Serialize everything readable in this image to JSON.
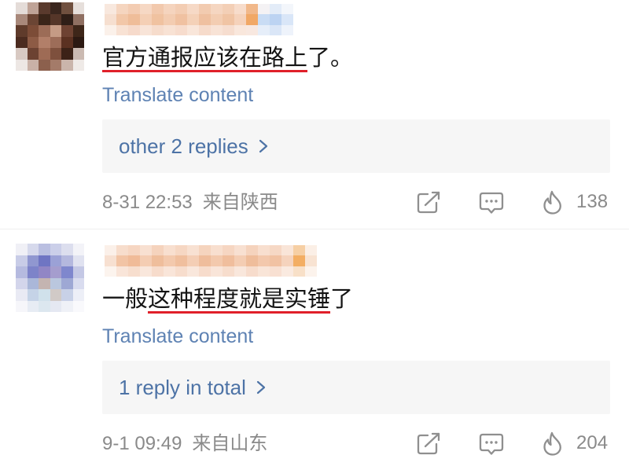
{
  "colors": {
    "text": "#141414",
    "link": "#5e82b3",
    "reply_link": "#4d73a6",
    "meta": "#8a8a8a",
    "icon": "#8f8f8f",
    "reply_background": "#f6f6f6",
    "annotation_red": "#e0202a",
    "divider": "#efefef"
  },
  "icons": {
    "share": "share-icon",
    "comment": "comment-icon",
    "like": "like-icon",
    "replies": "chevron-right-icon"
  },
  "comments": [
    {
      "avatar_mosaic": [
        [
          "#e4dcd8",
          "#bfa397",
          "#5a3a2d",
          "#3a261e",
          "#70503f",
          "#e6dfdb"
        ],
        [
          "#a8887a",
          "#6b4534",
          "#3b2519",
          "#553629",
          "#2f1e17",
          "#8f6f61"
        ],
        [
          "#5f3b2b",
          "#7c4c37",
          "#9c6c57",
          "#c59b85",
          "#6e4232",
          "#3e2619"
        ],
        [
          "#4b2b1f",
          "#8d5b45",
          "#b27f69",
          "#9d6d59",
          "#5b3121",
          "#2c1912"
        ],
        [
          "#d8c9c2",
          "#6c4232",
          "#9e6b55",
          "#7e503d",
          "#3c2217",
          "#cbbab2"
        ],
        [
          "#ede7e4",
          "#c9b1a7",
          "#8c604d",
          "#a47b69",
          "#cab5ab",
          "#efeae7"
        ]
      ],
      "username_mosaic": [
        [
          "#f8e8de",
          "#f5d5bf",
          "#f3ccb2",
          "#f6d8c4",
          "#f2c9ad",
          "#f5d4be",
          "#f3cdb3",
          "#f6d9c6",
          "#f2cbb0",
          "#f5d6c1",
          "#f3cfb6",
          "#f7dccb",
          "#f1b88a",
          "#f4f2f4",
          "#e3ecf8",
          "#f3f6fb"
        ],
        [
          "#f6dfd0",
          "#f2c7a8",
          "#efbd99",
          "#f4cfb5",
          "#f0c2a0",
          "#f3ccb1",
          "#f0c1a1",
          "#f4d1b8",
          "#efc0a0",
          "#f3cdb2",
          "#f0c4a4",
          "#f5d2bb",
          "#f1a866",
          "#c9dcf4",
          "#bcd3f2",
          "#d9e6f8"
        ],
        [
          "#fbf1ea",
          "#f8e2d4",
          "#f6dacb",
          "#f8e4d8",
          "#f6dccc",
          "#f8e2d4",
          "#f7dccd",
          "#f9e6da",
          "#f6dbcb",
          "#f8e3d6",
          "#f6ddcf",
          "#f9e7dc",
          "#f8e8e0",
          "#e6eef9",
          "#dae6f7",
          "#eef3fb"
        ]
      ],
      "text": [
        {
          "t": "官方通报应该在路上",
          "red_underline": true
        },
        {
          "t": "了。",
          "red_underline": false
        }
      ],
      "translate_label": "Translate content",
      "replies_label": "other 2 replies",
      "time": "8-31 22:53",
      "location": "来自陕西",
      "like_count": "138"
    },
    {
      "avatar_mosaic": [
        [
          "#f0f0f6",
          "#d6d9ec",
          "#babfe1",
          "#cbcfe9",
          "#dcdeee",
          "#f3f3f8"
        ],
        [
          "#c8cce7",
          "#9097d0",
          "#6f75c3",
          "#9ba1d6",
          "#b4b8de",
          "#e0e2f0"
        ],
        [
          "#b5badf",
          "#7d83c9",
          "#9186c5",
          "#a59dce",
          "#7f87cd",
          "#c4c8e5"
        ],
        [
          "#d3d5eb",
          "#aab7d9",
          "#c4b4b1",
          "#bac7de",
          "#9ea8d4",
          "#d9dcef"
        ],
        [
          "#e9eaf4",
          "#c5d3e7",
          "#d0e1eb",
          "#d1cac7",
          "#c8d1e7",
          "#edeff7"
        ],
        [
          "#f6f6fa",
          "#e7ecf4",
          "#dce7ef",
          "#e5e8f2",
          "#eff1f7",
          "#f9f9fc"
        ]
      ],
      "username_mosaic": [
        [
          "#fbf0e9",
          "#f7ddcc",
          "#f6d6c2",
          "#f8e0d1",
          "#f5d3bd",
          "#f8dfcf",
          "#f6d7c3",
          "#f8e1d2",
          "#f5d4be",
          "#f8dfcf",
          "#f6d6c2",
          "#f8e0d1",
          "#f5d3bd",
          "#f8dfcf",
          "#f6d8c5",
          "#f9e5d8",
          "#f6cfa4",
          "#fbefe6"
        ],
        [
          "#f7e0d1",
          "#f2c4a5",
          "#f0bb98",
          "#f4cdb3",
          "#efbe9c",
          "#f3c9ad",
          "#f0bf9e",
          "#f4ceb5",
          "#efbd9c",
          "#f3c9ad",
          "#f0be9d",
          "#f4cdb3",
          "#efbd9b",
          "#f3c8ac",
          "#f1c2a3",
          "#f5d3bd",
          "#f3ae63",
          "#f8e3d2"
        ],
        [
          "#fcf4ee",
          "#f9e5d9",
          "#f7dece",
          "#f9e7dc",
          "#f7dccc",
          "#f9e5d9",
          "#f7ddcd",
          "#f9e7dc",
          "#f7dccc",
          "#f9e5d9",
          "#f7ddcd",
          "#f9e7dc",
          "#f7dccc",
          "#f9e5d8",
          "#f8e0d2",
          "#faeae0",
          "#f8e0c8",
          "#fcf3ec"
        ]
      ],
      "text": [
        {
          "t": "一般",
          "red_underline": false
        },
        {
          "t": "这种程度就是实锤",
          "red_underline": true
        },
        {
          "t": "了",
          "red_underline": false
        }
      ],
      "translate_label": "Translate content",
      "replies_label": "1 reply in total",
      "time": "9-1 09:49",
      "location": "来自山东",
      "like_count": "204"
    }
  ]
}
